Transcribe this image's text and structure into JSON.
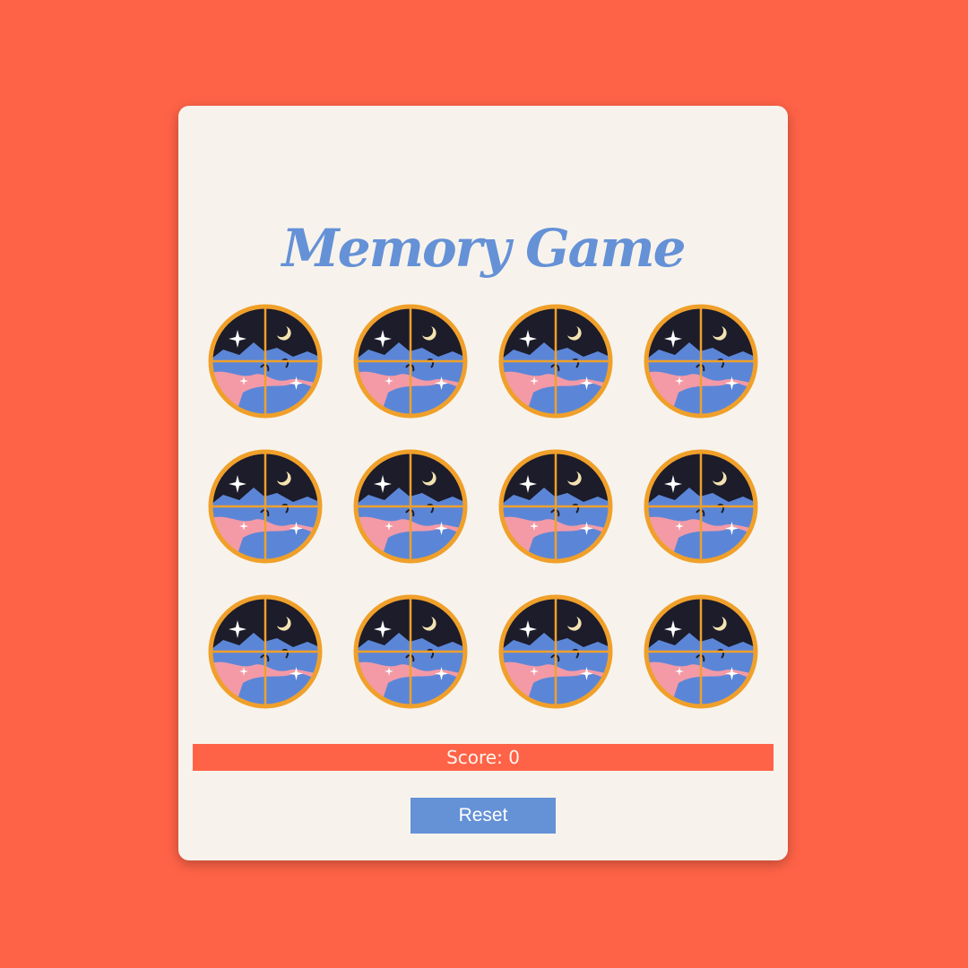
{
  "game": {
    "title": "Memory Game",
    "score_text": "Score: 0",
    "reset_label": "Reset",
    "grid": {
      "rows": 3,
      "columns": 4
    },
    "tiles": [
      {
        "state": "face-down",
        "icon": "night-window-card-back-icon"
      },
      {
        "state": "face-down",
        "icon": "night-window-card-back-icon"
      },
      {
        "state": "face-down",
        "icon": "night-window-card-back-icon"
      },
      {
        "state": "face-down",
        "icon": "night-window-card-back-icon"
      },
      {
        "state": "face-down",
        "icon": "night-window-card-back-icon"
      },
      {
        "state": "face-down",
        "icon": "night-window-card-back-icon"
      },
      {
        "state": "face-down",
        "icon": "night-window-card-back-icon"
      },
      {
        "state": "face-down",
        "icon": "night-window-card-back-icon"
      },
      {
        "state": "face-down",
        "icon": "night-window-card-back-icon"
      },
      {
        "state": "face-down",
        "icon": "night-window-card-back-icon"
      },
      {
        "state": "face-down",
        "icon": "night-window-card-back-icon"
      },
      {
        "state": "face-down",
        "icon": "night-window-card-back-icon"
      }
    ]
  },
  "colors": {
    "page_background": "#ff6347",
    "card_background": "#f7f3ec",
    "accent_blue": "#6591d6",
    "tile_frame": "#f0a02a",
    "tile_sky": "#1c1c2a",
    "tile_hill_blue": "#5b86d8",
    "tile_hill_pink": "#f39aa6",
    "tile_moon": "#f2e2b0"
  }
}
